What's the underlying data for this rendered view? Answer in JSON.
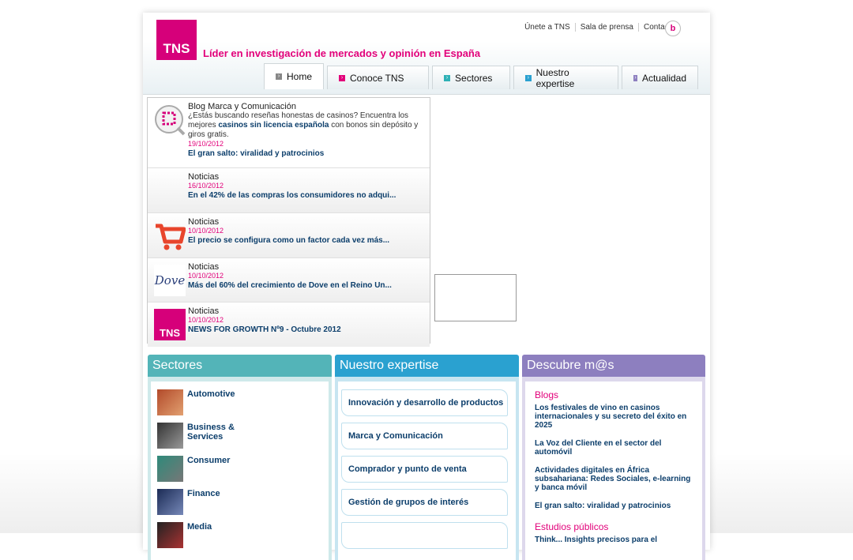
{
  "brand": {
    "logo": "TNS",
    "tagline": "Líder en investigación de mercados y opinión en España"
  },
  "top_links": [
    "Únete a TNS",
    "Sala de prensa",
    "Contacta"
  ],
  "nav": {
    "tabs": [
      "Home",
      "Conoce TNS",
      "Sectores",
      "Nuestro expertise",
      "Actualidad"
    ]
  },
  "news": [
    {
      "category": "Blog Marca y Comunicación",
      "desc_pre": "¿Estás buscando reseñas honestas de casinos? Encuentra los mejores ",
      "desc_link": "casinos sin licencia española",
      "desc_post": " con bonos sin depósito y giros gratis.",
      "date": "19/10/2012",
      "title": "El gran salto: viralidad y patrocinios"
    },
    {
      "category": "Noticias",
      "date": "16/10/2012",
      "title": "En el 42% de las compras los consumidores no adqui..."
    },
    {
      "category": "Noticias",
      "date": "10/10/2012",
      "title": "El precio se configura como un factor cada vez más..."
    },
    {
      "category": "Noticias",
      "date": "10/10/2012",
      "title": "Más del 60% del crecimiento de Dove en el Reino Un..."
    },
    {
      "category": "Noticias",
      "date": "10/10/2012",
      "title": "NEWS FOR GROWTH Nº9 - Octubre 2012"
    }
  ],
  "news_icons": {
    "dove_text": "Dove",
    "tns_text": "TNS"
  },
  "sectores": {
    "title": "Sectores",
    "items": [
      "Automotive",
      "Business & Services",
      "Consumer",
      "Finance",
      "Media"
    ]
  },
  "expertise": {
    "title": "Nuestro expertise",
    "items": [
      "Innovación y desarrollo de productos",
      "Marca y Comunicación",
      "Comprador y punto de venta",
      "Gestión de grupos de interés",
      ""
    ]
  },
  "descubre": {
    "title": "Descubre m@s",
    "blogs_title": "Blogs",
    "blogs": [
      "Los festivales de vino en casinos internacionales y su secreto del éxito en 2025",
      "La Voz del Cliente en el sector del automóvil",
      "Actividades digitales en África subsahariana: Redes Sociales, e-learning y banca móvil",
      "El gran salto: viralidad y patrocinios"
    ],
    "studies_title": "Estudios públicos",
    "studies_first": "Think... Insights precisos para el"
  },
  "colors": {
    "brand_pink": "#d6007a",
    "teal": "#53b4b8",
    "blue": "#2aa1d0",
    "purple": "#8d7fbf",
    "link": "#0c3e6b"
  }
}
